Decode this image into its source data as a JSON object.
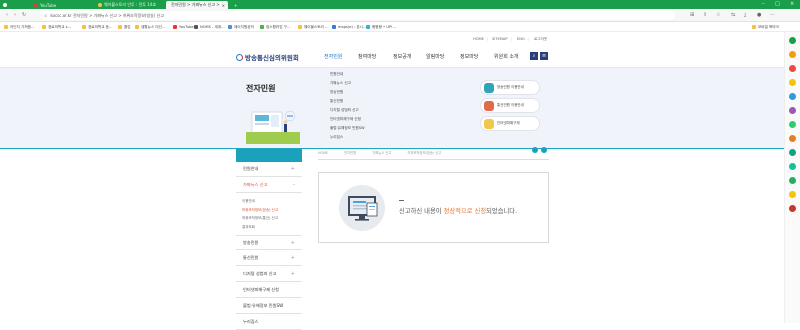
{
  "browser": {
    "tabs": [
      {
        "title": "YouTube",
        "active": false
      },
      {
        "title": "웨이블스토리 안투 : 전투 14호",
        "active": false
      },
      {
        "title": "전자민원 > 가짜뉴스 신고 >",
        "active": true
      }
    ],
    "new_tab_label": "+",
    "url": "kocsc.or.kr 전자민원 > 가짜뉴스 신고 > 허위조작정보(방송) 신고",
    "bookmarks": [
      "어딘지 가져옴…",
      "경로의학교 s…",
      "경로의학교 등…",
      "졸업",
      "생활뉴스 미선…",
      "YouTube",
      "NOMS - 세계…",
      "제이지원공의",
      "컴스활러업 구…",
      "웨이블스토리 …",
      "maps(e) : 폰시…",
      "왕왕왕 • UP!…"
    ],
    "bookmark_right": "모바일 북마크"
  },
  "header": {
    "util_links": [
      "HOME",
      "SITEMAP",
      "ENG",
      "로그아웃"
    ],
    "logo": "방송통신심의위원회",
    "gnb": [
      {
        "label": "전자민원",
        "active": true
      },
      {
        "label": "참여마당",
        "active": false
      },
      {
        "label": "정보공개",
        "active": false
      },
      {
        "label": "알림마당",
        "active": false
      },
      {
        "label": "정보마당",
        "active": false
      },
      {
        "label": "위원회 소개",
        "active": false
      }
    ]
  },
  "mega_menu": {
    "title": "전자민원",
    "items": [
      "민원안내",
      "가짜뉴스 신고",
      "방송민원",
      "통신민원",
      "디지털 성범죄 신고",
      "인터넷피해구제 신청",
      "불법·유해정보 민원SW",
      "누리집스"
    ],
    "quick_links": [
      "방송민원 이용안내",
      "통신민원 이용안내",
      "인터넷피해구제"
    ]
  },
  "lnb": {
    "items": [
      {
        "label": "민원안내",
        "open": false
      },
      {
        "label": "가짜뉴스 신고",
        "open": true
      }
    ],
    "sub_items": [
      {
        "label": "이용안내",
        "active": false
      },
      {
        "label": "허위조작정보(방송) 신고",
        "active": true
      },
      {
        "label": "허위조작정보(통신) 신고",
        "active": false
      },
      {
        "label": "결과조회",
        "active": false
      }
    ],
    "more_items": [
      "방송민원",
      "통신민원",
      "디지털 성범죄 신고",
      "인터넷피해구제 신청",
      "불법·유해정보 민원SW",
      "누리집스"
    ]
  },
  "breadcrumb": [
    "HOME",
    "전자민원",
    "가짜뉴스 신고",
    "허위조작정보(방송) 신고"
  ],
  "result": {
    "dash": "—",
    "msg_prefix": "신고하신 내용이 ",
    "msg_highlight": "정상적으로 신청",
    "msg_suffix": "되었습니다."
  },
  "colors": {
    "tab_green": "#1b9e49",
    "brand_navy": "#2a3f7a",
    "accent_blue": "#1670c8",
    "teal": "#1aa2bd",
    "highlight_orange": "#e2712d"
  }
}
